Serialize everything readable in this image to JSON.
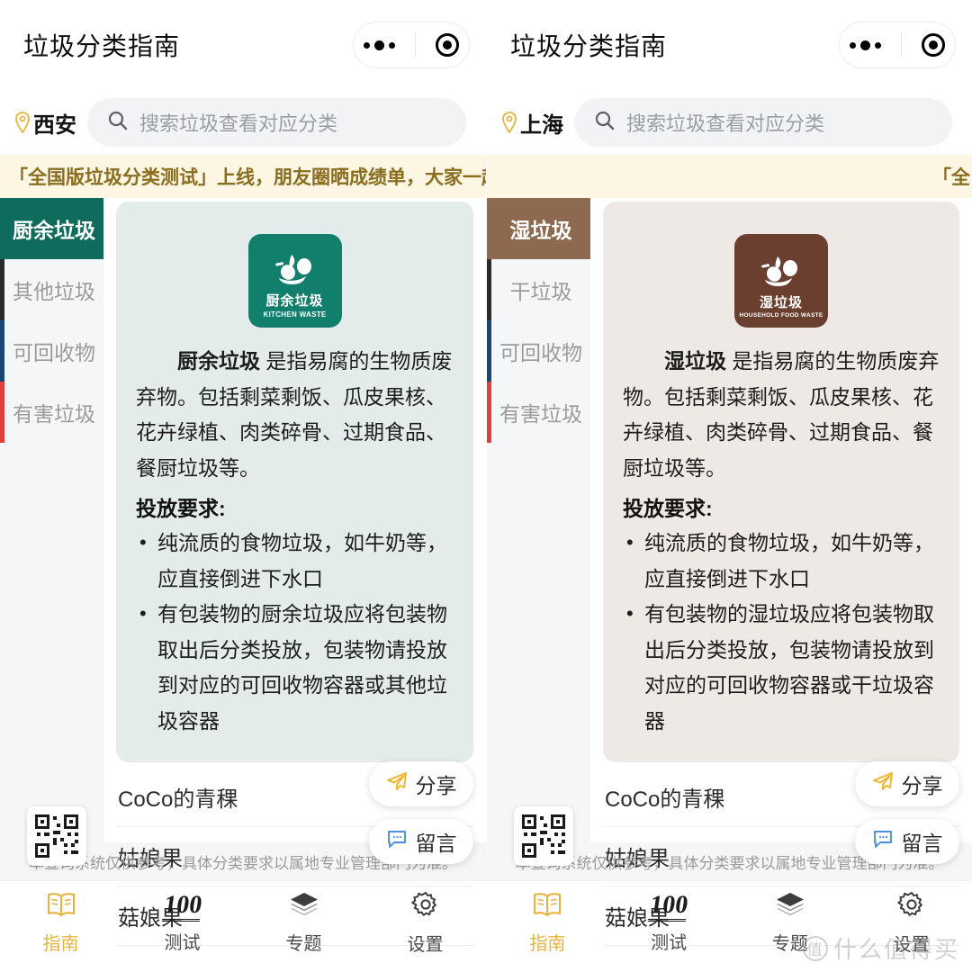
{
  "header": {
    "title": "垃圾分类指南",
    "capsule": {
      "more_icon": "more-dots-icon",
      "target_icon": "target-icon"
    }
  },
  "notice": {
    "full_text": "「全国版垃圾分类测试」上线，朋友圈晒成绩单，大家一起来比拼！",
    "partial_text": "「全",
    "bg_color": "#fdf6e3",
    "text_color": "#8a6d1f"
  },
  "search": {
    "placeholder": "搜索垃圾查看对应分类",
    "icon": "search-icon",
    "pin_icon": "location-pin-icon"
  },
  "footer_note": "本查询系统仅供参考，具体分类要求以属地专业管理部门为准。",
  "tabbar": {
    "items": [
      {
        "label": "指南",
        "icon": "open-book-icon",
        "active": true
      },
      {
        "label": "测试",
        "icon": "hundred-points-icon",
        "active": false
      },
      {
        "label": "专题",
        "icon": "layers-icon",
        "active": false
      },
      {
        "label": "设置",
        "icon": "gear-icon",
        "active": false
      }
    ]
  },
  "fabs": [
    {
      "label": "分享",
      "icon": "paper-plane-icon",
      "color": "#f0b429"
    },
    {
      "label": "留言",
      "icon": "comment-bubble-icon",
      "color": "#4a90e2"
    }
  ],
  "qr": {
    "name": "qr-code-icon"
  },
  "watermark": {
    "text": "什么值得买",
    "mark": "值"
  },
  "screens": [
    {
      "id": "xian",
      "city": "西安",
      "accent": "#0f6b5c",
      "card_bg": "#e3ecea",
      "badge_bg": "#117f6b",
      "notice_state": "full",
      "tabs": [
        {
          "label": "厨余垃圾",
          "active": true,
          "bar_color": ""
        },
        {
          "label": "其他垃圾",
          "active": false,
          "bar_color": "#2b2b2b"
        },
        {
          "label": "可回收物",
          "active": false,
          "bar_color": "#17457c"
        },
        {
          "label": "有害垃圾",
          "active": false,
          "bar_color": "#e0403a"
        }
      ],
      "badge": {
        "cn": "厨余垃圾",
        "en": "KITCHEN WASTE"
      },
      "desc_lead": "厨余垃圾",
      "desc_rest": " 是指易腐的生物质废弃物。包括剩菜剩饭、瓜皮果核、花卉绿植、肉类碎骨、过期食品、餐厨垃圾等。",
      "req_title": "投放要求:",
      "reqs": [
        "纯流质的食物垃圾，如牛奶等，应直接倒进下水口",
        "有包装物的厨余垃圾应将包装物取出后分类投放，包装物请投放到对应的可回收物容器或其他垃圾容器"
      ],
      "list": [
        "CoCo的青稞",
        "姑娘果",
        "菇娘果"
      ]
    },
    {
      "id": "shanghai",
      "city": "上海",
      "accent": "#8d6950",
      "card_bg": "#eee9e5",
      "badge_bg": "#6b3f2f",
      "notice_state": "partial",
      "tabs": [
        {
          "label": "湿垃圾",
          "active": true,
          "bar_color": ""
        },
        {
          "label": "干垃圾",
          "active": false,
          "bar_color": "#2b2b2b"
        },
        {
          "label": "可回收物",
          "active": false,
          "bar_color": "#17457c"
        },
        {
          "label": "有害垃圾",
          "active": false,
          "bar_color": "#e0403a"
        }
      ],
      "badge": {
        "cn": "湿垃圾",
        "en": "HOUSEHOLD FOOD WASTE"
      },
      "desc_lead": "湿垃圾",
      "desc_rest": " 是指易腐的生物质废弃物。包括剩菜剩饭、瓜皮果核、花卉绿植、肉类碎骨、过期食品、餐厨垃圾等。",
      "req_title": "投放要求:",
      "reqs": [
        "纯流质的食物垃圾，如牛奶等，应直接倒进下水口",
        "有包装物的湿垃圾应将包装物取出后分类投放，包装物请投放到对应的可回收物容器或干垃圾容器"
      ],
      "list": [
        "CoCo的青稞",
        "姑娘果",
        "菇娘果"
      ]
    }
  ]
}
